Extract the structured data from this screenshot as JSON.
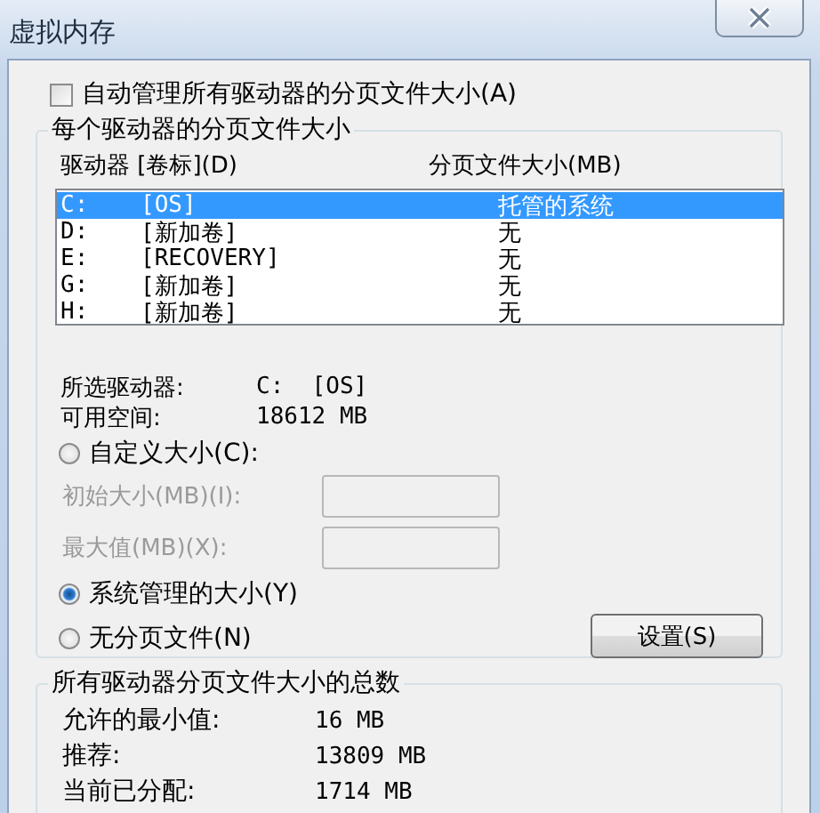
{
  "window": {
    "title": "虚拟内存"
  },
  "auto_manage": {
    "label": "自动管理所有驱动器的分页文件大小(A)",
    "checked": false
  },
  "per_drive": {
    "title": "每个驱动器的分页文件大小",
    "columns": [
      "驱动器 [卷标](D)",
      "分页文件大小(MB)"
    ],
    "rows": [
      {
        "drive": "C:",
        "volume": "[OS]",
        "size": "托管的系统",
        "selected": true
      },
      {
        "drive": "D:",
        "volume": "[新加卷]",
        "size": "无",
        "selected": false
      },
      {
        "drive": "E:",
        "volume": "[RECOVERY]",
        "size": "无",
        "selected": false
      },
      {
        "drive": "G:",
        "volume": "[新加卷]",
        "size": "无",
        "selected": false
      },
      {
        "drive": "H:",
        "volume": "[新加卷]",
        "size": "无",
        "selected": false
      }
    ],
    "info": [
      {
        "label": "所选驱动器:",
        "value": "C:  [OS]"
      },
      {
        "label": "可用空间:",
        "value": "18612 MB"
      }
    ],
    "size_options": [
      {
        "label": "自定义大小(C):",
        "selected": false
      },
      {
        "label": "系统管理的大小(Y)",
        "selected": true
      },
      {
        "label": "无分页文件(N)",
        "selected": false
      }
    ],
    "custom_fields": [
      {
        "label": "初始大小(MB)(I):",
        "disabled": true
      },
      {
        "label": "最大值(MB)(X):",
        "disabled": true
      }
    ],
    "set_button": {
      "label": "设置(S)"
    }
  },
  "totals": {
    "title": "所有驱动器分页文件大小的总数",
    "rows": [
      {
        "label": "允许的最小值:",
        "value": "16 MB"
      },
      {
        "label": "推荐:",
        "value": "13809 MB"
      },
      {
        "label": "当前已分配:",
        "value": "1714 MB"
      }
    ]
  }
}
